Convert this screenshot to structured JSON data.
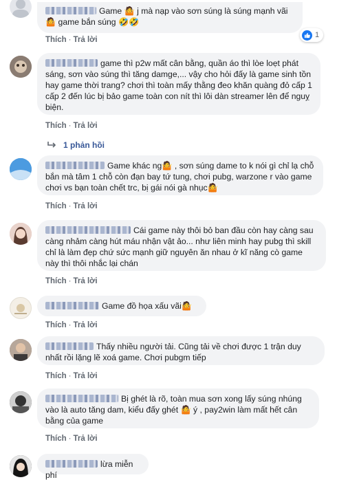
{
  "actions": {
    "like": "Thích",
    "reply": "Trả lời"
  },
  "comments": [
    {
      "text": "Game 🤷 j mà nạp vào sơn súng là súng mạnh vãi🤷 game bắn súng 🤣🤣",
      "reaction_count": "1"
    },
    {
      "text": "game thì p2w mất cân bằng, quần áo thì lòe loẹt phát sáng, sơn vào súng thì tăng damge,... vậy cho hỏi đấy là game sinh tồn hay game thời trang? chơi thì toàn mấy thằng đeo khăn quàng đỏ cấp 1 cấp 2 đến lúc bị bảo game toàn con nít thì lôi dàn streamer lên để nguỵ biện.",
      "replies_label": "1 phản hồi"
    },
    {
      "text": "Game khác ng🤷 , sơn súng dame to k nói gì chỉ lạ chỗ bắn mà tâm 1 chỗ còn đạn bay tứ tung, chơi pubg, warzone r vào game chơi vs bạn toàn chết trc, bị gái nói gà nhục🤷"
    },
    {
      "text": "Cái game này thôi bỏ ban đầu còn hay càng sau càng nhảm càng hút máu nhận vật ảo... như liên minh hay pubg thì skill chỉ là làm đẹp chứ sức mạnh giữ nguyên ăn nhau ở kĩ năng cò game này thì thôi nhắc lại chán"
    },
    {
      "text": "Game đồ họa xấu vãi🤷"
    },
    {
      "text": "Thấy nhiều người tải. Cũng tải về chơi được 1 trận duy nhất rồi lặng lẽ xoá game. Chơi pubgm tiếp"
    },
    {
      "text": "Bị ghét là rõ, toàn mua sơn xong lấy súng nhúng vào là auto tăng dam, kiểu đấy ghét 🤷 ý , pay2win làm mất hết cân bằng của game"
    },
    {
      "text": "lừa miễn phí"
    }
  ],
  "colors": {
    "bubble": "#f2f3f5",
    "link": "#385898",
    "like_blue": "#1877f2",
    "meta": "#606770"
  },
  "icons": [
    "reply-arrow-icon",
    "like-thumb-icon"
  ]
}
